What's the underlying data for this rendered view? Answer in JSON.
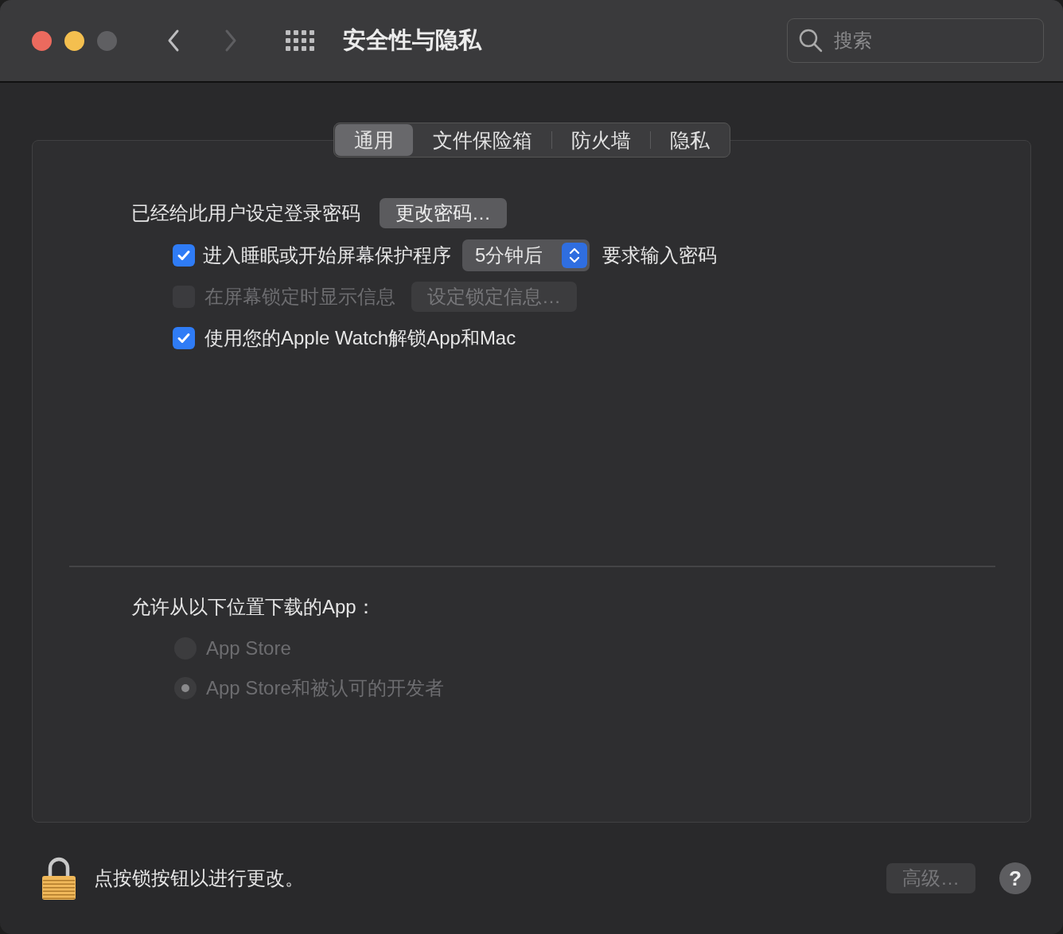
{
  "window": {
    "title": "安全性与隐私"
  },
  "traffic_lights": [
    {
      "color": "#ec6a5e"
    },
    {
      "color": "#f4bf4f"
    },
    {
      "color": "#5f5f62"
    }
  ],
  "nav": [
    {
      "kind": "back",
      "disabled": false
    },
    {
      "kind": "forward",
      "disabled": true
    }
  ],
  "search": {
    "placeholder": "搜索"
  },
  "tabs": [
    {
      "label": "通用",
      "selected": true
    },
    {
      "label": "文件保险箱",
      "selected": false
    },
    {
      "label": "防火墙",
      "selected": false
    },
    {
      "label": "隐私",
      "selected": false
    }
  ],
  "password_row": {
    "label": "已经给此用户设定登录密码",
    "button": "更改密码…"
  },
  "options": [
    {
      "kind": "checkbox-select",
      "checked": true,
      "disabled": false,
      "label": "进入睡眠或开始屏幕保护程序",
      "select": "5分钟后",
      "suffix": "要求输入密码"
    },
    {
      "kind": "checkbox-button",
      "checked": false,
      "disabled": true,
      "label": "在屏幕锁定时显示信息",
      "button": "设定锁定信息…"
    },
    {
      "kind": "checkbox",
      "checked": true,
      "disabled": false,
      "label": "使用您的Apple Watch解锁App和Mac"
    }
  ],
  "downloads": {
    "label": "允许从以下位置下载的App：",
    "options": [
      {
        "label": "App Store",
        "selected": false,
        "disabled": true
      },
      {
        "label": "App Store和被认可的开发者",
        "selected": true,
        "disabled": true
      }
    ]
  },
  "footer": {
    "locked": true,
    "lock_text": "点按锁按钮以进行更改。",
    "advanced_button": "高级…",
    "advanced_disabled": true,
    "help": "?"
  }
}
